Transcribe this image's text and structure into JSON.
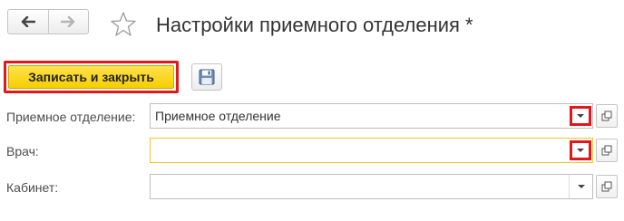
{
  "header": {
    "title": "Настройки приемного отделения *",
    "back_icon": "arrow-left-icon",
    "forward_icon": "arrow-right-icon",
    "favorite_icon": "star-icon"
  },
  "toolbar": {
    "save_close_label": "Записать и закрыть",
    "save_icon": "floppy-disk-icon"
  },
  "form": {
    "fields": [
      {
        "label": "Приемное отделение:",
        "value": "Приемное отделение"
      },
      {
        "label": "Врач:",
        "value": ""
      },
      {
        "label": "Кабинет:",
        "value": ""
      }
    ]
  },
  "colors": {
    "primary_button": "#f6cf00",
    "highlight_frame": "#e0171b",
    "focused_field_border": "#f0c42c"
  }
}
